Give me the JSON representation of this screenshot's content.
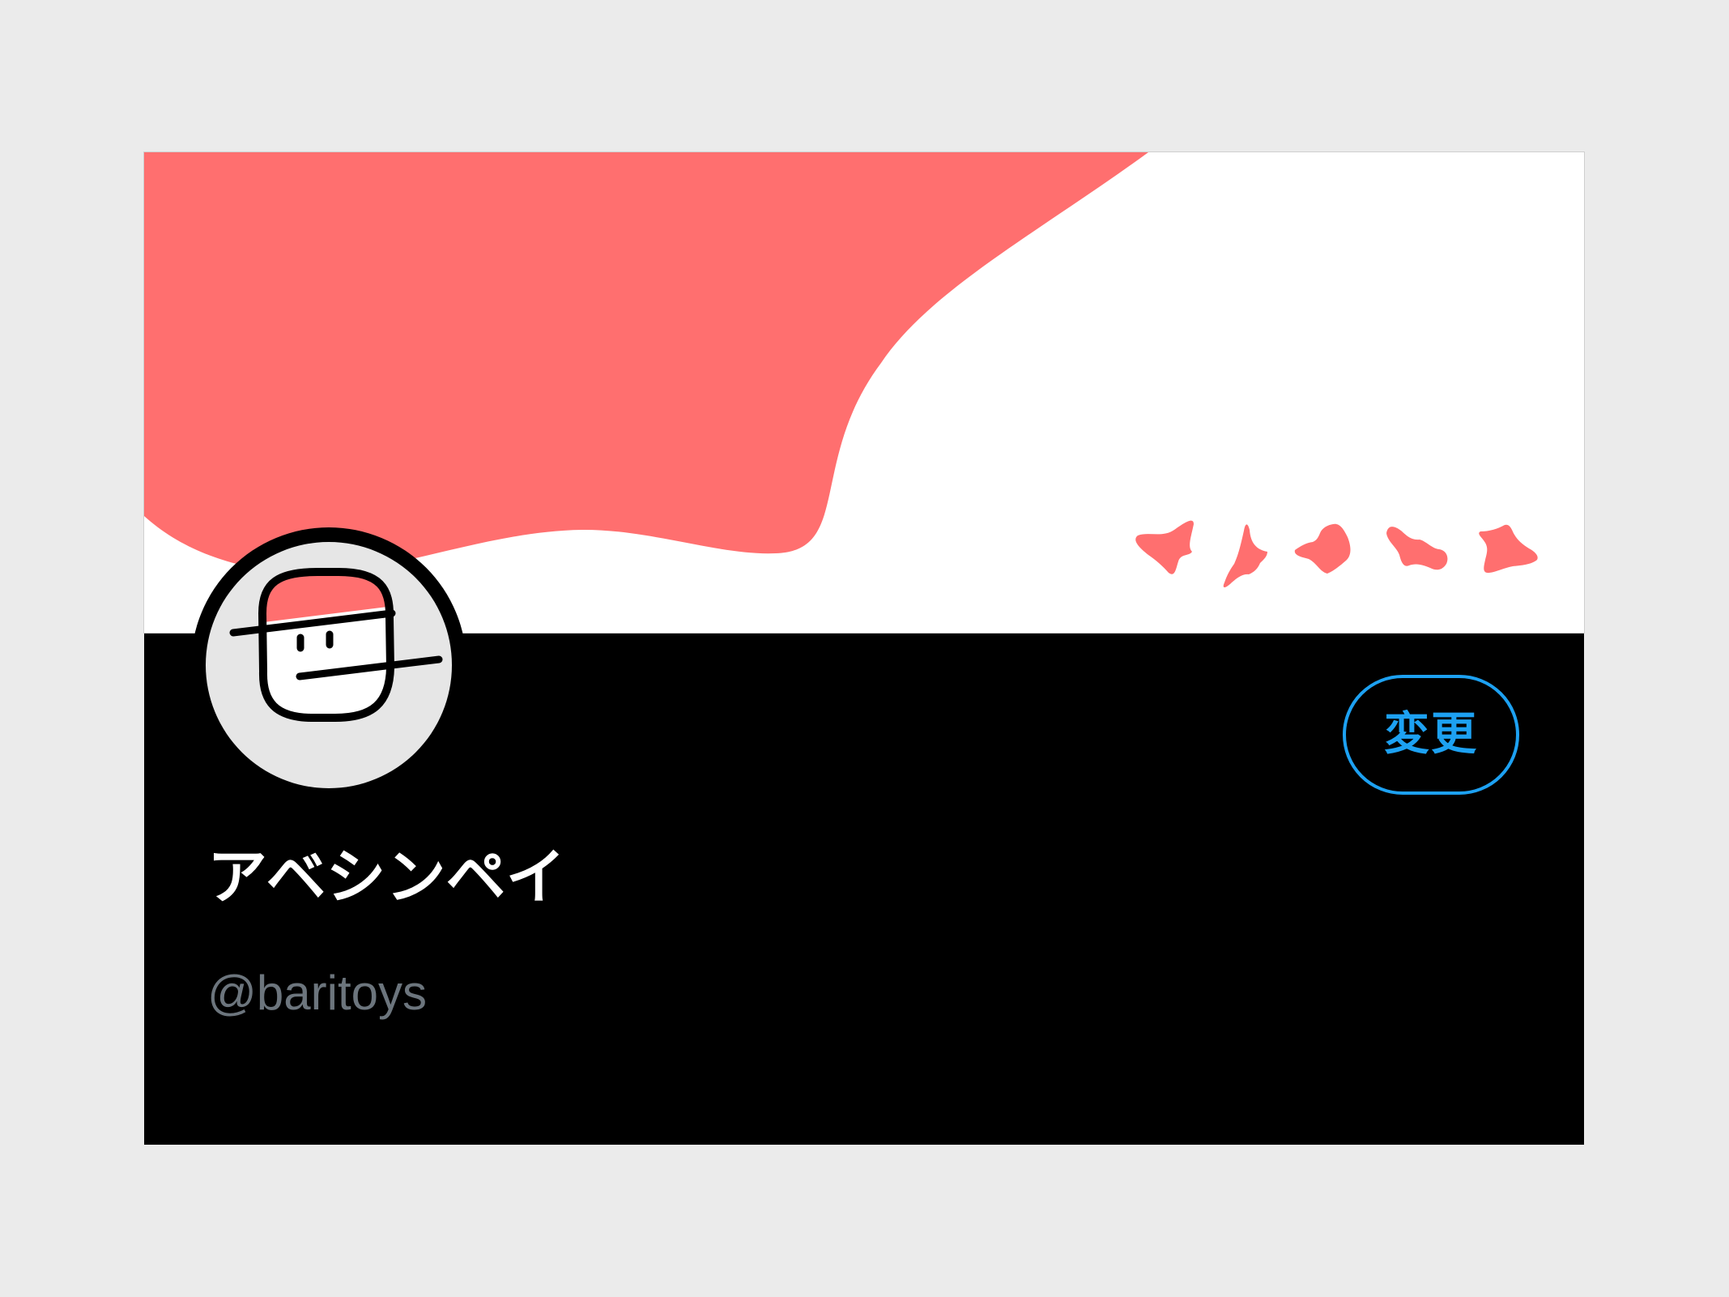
{
  "profile": {
    "display_name": "アベシンペイ",
    "handle": "@baritoys",
    "change_label": "変更"
  },
  "colors": {
    "background": "#ebebeb",
    "card_background": "#000000",
    "header_background": "#ffffff",
    "accent": "#ff6f6f",
    "button_accent": "#1da1f2",
    "handle_text": "#6c757d",
    "avatar_background": "#e6e6e6"
  },
  "icons": {
    "avatar": "capped-face-avatar-icon",
    "decorations": "coral-splash-icons"
  }
}
